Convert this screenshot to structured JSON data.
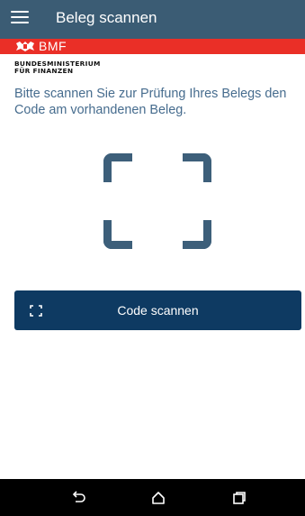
{
  "app_bar": {
    "title": "Beleg scannen",
    "menu_icon": "hamburger-menu-icon"
  },
  "brand": {
    "logo_text": "BMF",
    "logo_icon": "eagle-emblem",
    "ministry_line1": "BUNDESMINISTERIUM",
    "ministry_line2": "FÜR FINANZEN",
    "stripe_color": "#ea2f27"
  },
  "main": {
    "instruction": "Bitte scannen Sie zur Prüfung Ihres Belegs den Code am vorhandenen Beleg.",
    "viewfinder_icon": "scan-frame-icon"
  },
  "scan_button": {
    "label": "Code scannen",
    "icon": "scan-frame-icon"
  },
  "system_nav": {
    "back_icon": "back-icon",
    "home_icon": "home-icon",
    "recent_icon": "recent-apps-icon"
  },
  "colors": {
    "app_bar": "#3b5c74",
    "accent_text": "#466c8e",
    "button": "#0e3a62",
    "viewfinder": "#3d5f7a"
  }
}
